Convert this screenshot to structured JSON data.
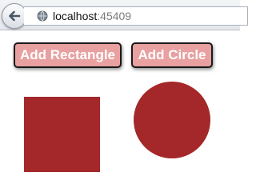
{
  "browser": {
    "url_host": "localhost",
    "url_port": ":45409"
  },
  "toolbar": {
    "add_rectangle_label": "Add Rectangle",
    "add_circle_label": "Add Circle"
  },
  "colors": {
    "shape_fill": "#a4272a",
    "button_background": "#e8a0a0",
    "button_text": "#ffffff",
    "button_border": "#1a1a1a"
  },
  "icons": {
    "back": "back-arrow-icon",
    "site": "globe-icon"
  },
  "shapes": [
    {
      "type": "rectangle"
    },
    {
      "type": "circle"
    }
  ]
}
